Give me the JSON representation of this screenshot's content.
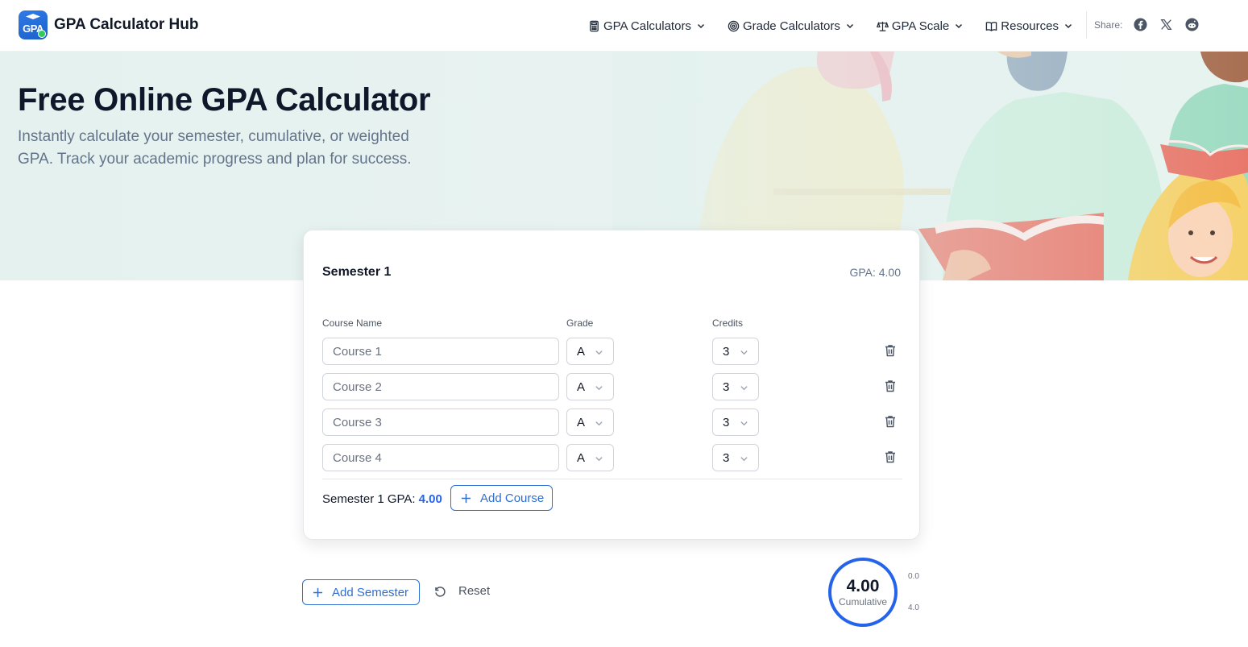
{
  "header": {
    "logo_text": "GPA",
    "brand": "GPA Calculator Hub",
    "nav": [
      {
        "label": "GPA Calculators",
        "icon": "calculator-icon"
      },
      {
        "label": "Grade Calculators",
        "icon": "target-icon"
      },
      {
        "label": "GPA Scale",
        "icon": "scale-icon"
      },
      {
        "label": "Resources",
        "icon": "book-icon"
      }
    ],
    "share_label": "Share:",
    "social": [
      "facebook-icon",
      "x-icon",
      "reddit-icon"
    ]
  },
  "hero": {
    "title": "Free Online GPA Calculator",
    "subtitle": "Instantly calculate your semester, cumulative, or weighted GPA. Track your academic progress and plan for success."
  },
  "semester": {
    "title": "Semester 1",
    "gpa_label": "GPA: 4.00",
    "columns": {
      "course": "Course Name",
      "grade": "Grade",
      "credits": "Credits"
    },
    "courses": [
      {
        "placeholder": "Course 1",
        "grade": "A",
        "credits": "3"
      },
      {
        "placeholder": "Course 2",
        "grade": "A",
        "credits": "3"
      },
      {
        "placeholder": "Course 3",
        "grade": "A",
        "credits": "3"
      },
      {
        "placeholder": "Course 4",
        "grade": "A",
        "credits": "3"
      }
    ],
    "footer_label": "Semester 1 GPA:",
    "footer_value": "4.00",
    "add_course": "Add Course"
  },
  "actions": {
    "add_semester": "Add Semester",
    "reset": "Reset"
  },
  "cumulative": {
    "value": "4.00",
    "label": "Cumulative",
    "scale_min": "0.0",
    "scale_max": "4.0"
  },
  "colors": {
    "accent": "#2563eb",
    "hero_bg": "#e6f2f0"
  }
}
